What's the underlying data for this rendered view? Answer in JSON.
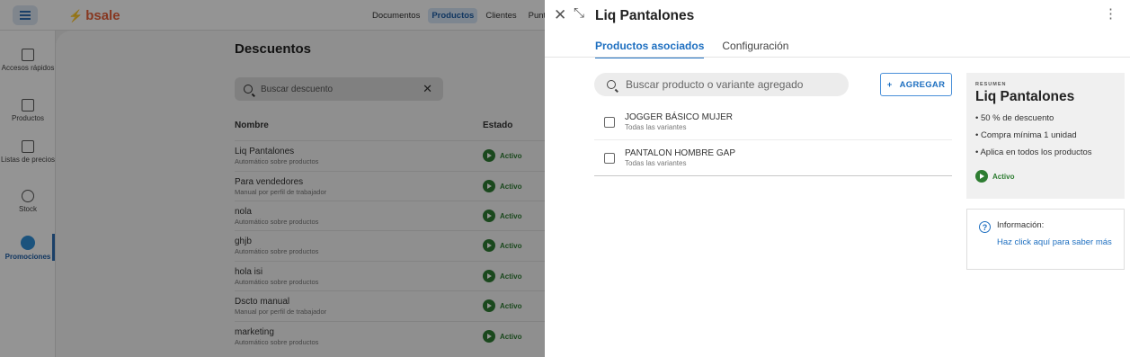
{
  "background": {
    "logo": "bsale",
    "topnav": [
      "Documentos",
      "Productos",
      "Clientes",
      "Punto d"
    ],
    "topnav_active": "Productos",
    "leftnav": [
      {
        "label": "Accesos rápidos",
        "icon": "grid-icon"
      },
      {
        "label": "Productos",
        "icon": "box-icon"
      },
      {
        "label": "Listas de precios",
        "icon": "price-list-icon"
      },
      {
        "label": "Stock",
        "icon": "stock-icon"
      },
      {
        "label": "Promociones",
        "icon": "promotions-icon",
        "active": true
      }
    ],
    "page_title": "Descuentos",
    "search_placeholder": "Buscar descuento",
    "columns": {
      "name": "Nombre",
      "status": "Estado"
    },
    "rows": [
      {
        "name": "Liq Pantalones",
        "sub": "Automático sobre productos",
        "status": "Activo"
      },
      {
        "name": "Para vendedores",
        "sub": "Manual por perfil de trabajador",
        "status": "Activo"
      },
      {
        "name": "nola",
        "sub": "Automático sobre productos",
        "status": "Activo"
      },
      {
        "name": "ghjb",
        "sub": "Automático sobre productos",
        "status": "Activo"
      },
      {
        "name": "hola isi",
        "sub": "Automático sobre productos",
        "status": "Activo"
      },
      {
        "name": "Dscto manual",
        "sub": "Manual por perfil de trabajador",
        "status": "Activo"
      },
      {
        "name": "marketing",
        "sub": "Automático sobre productos",
        "status": "Activo"
      }
    ]
  },
  "drawer": {
    "title": "Liq Pantalones",
    "tabs": [
      "Productos asociados",
      "Configuración"
    ],
    "search_placeholder": "Buscar producto o variante agregado",
    "add_button": "AGREGAR",
    "products": [
      {
        "name": "JOGGER BÁSICO MUJER",
        "sub": "Todas las variantes"
      },
      {
        "name": "PANTALON HOMBRE GAP",
        "sub": "Todas las variantes"
      }
    ],
    "summary": {
      "label": "RESUMEN",
      "title": "Liq Pantalones",
      "items": [
        "50 % de descuento",
        "Compra mínima 1 unidad",
        "Aplica en todos los productos"
      ],
      "status": "Activo"
    },
    "info": {
      "title": "Información:",
      "link": "Haz click aquí para saber más"
    }
  },
  "colors": {
    "accent": "#1e6fc0",
    "status_active": "#2e7d32",
    "brand": "#e8613a"
  }
}
